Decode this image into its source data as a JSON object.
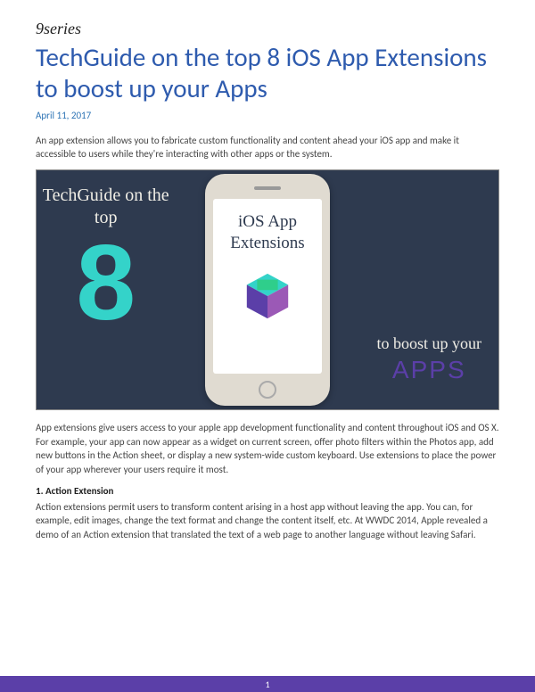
{
  "brand": "9series",
  "title": "TechGuide on the top 8 iOS App Extensions to boost up your Apps",
  "date": "April 11, 2017",
  "intro": "An app extension allows you to fabricate custom functionality and content ahead your iOS app and make it accessible to users while they're interacting with other apps or the system.",
  "hero": {
    "left_text": "TechGuide on the top",
    "big_number": "8",
    "phone_label_line1": "iOS App",
    "phone_label_line2": "Extensions",
    "right_text": "to boost up your",
    "right_apps": "APPS"
  },
  "body_para": "App extensions give users access to your apple app development functionality and content throughout iOS and OS X. For example, your app can now appear as a widget on current screen, offer photo filters within the Photos app, add new buttons in the Action sheet, or display a new system-wide custom keyboard. Use extensions to place the power of your app wherever your users require it most.",
  "section1": {
    "heading": "1. Action Extension",
    "body": "Action extensions permit users to transform content arising in a host app without leaving the app. You can, for example, edit images, change the text format and change the content itself, etc. At WWDC 2014, Apple revealed a demo of an Action extension that translated the text of a web page to another language without leaving Safari."
  },
  "page_number": "1",
  "colors": {
    "title": "#2E5BAE",
    "date": "#2E74B5",
    "hero_bg": "#2e3a4f",
    "accent_teal": "#34D3C9",
    "accent_purple": "#5B3FA8"
  }
}
